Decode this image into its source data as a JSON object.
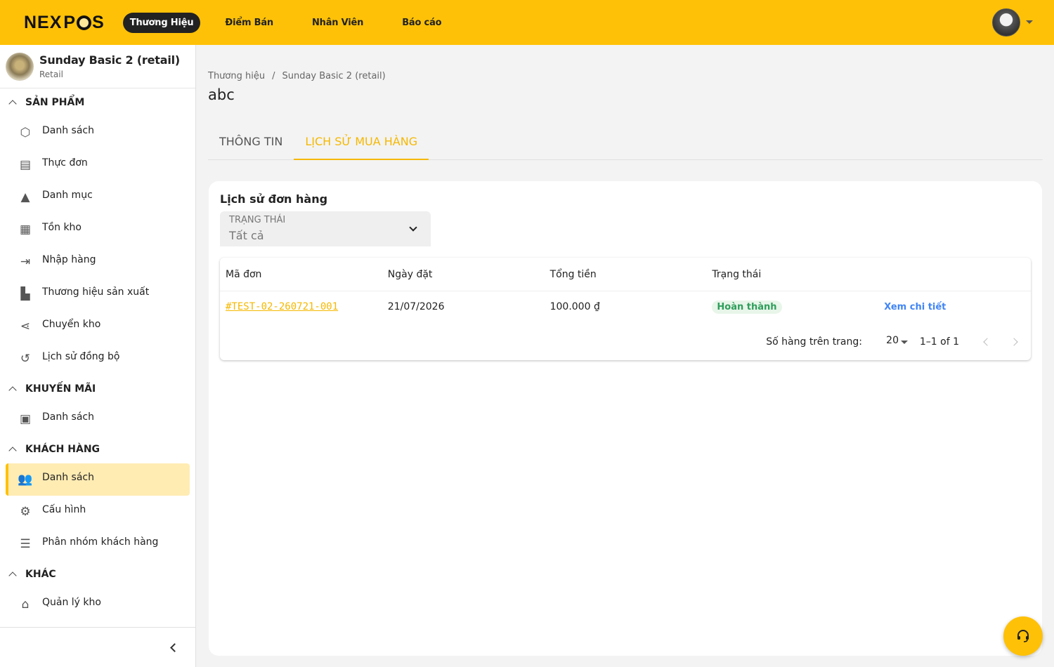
{
  "brand": {
    "logo_text": "NEXPOS",
    "accent": "#ffc107"
  },
  "nav": {
    "items": [
      "Thương Hiệu",
      "Điểm Bán",
      "Nhân Viên",
      "Báo cáo"
    ]
  },
  "store": {
    "name": "Sunday Basic 2 (retail)",
    "type": "Retail"
  },
  "sidebar": {
    "sections": [
      {
        "label": "SẢN PHẨM",
        "items": [
          "Danh sách",
          "Thực đơn",
          "Danh mục",
          "Tồn kho",
          "Nhập hàng",
          "Thương hiệu sản xuất",
          "Chuyển kho",
          "Lịch sử đồng bộ"
        ]
      },
      {
        "label": "KHUYẾN MÃI",
        "items": [
          "Danh sách"
        ]
      },
      {
        "label": "KHÁCH HÀNG",
        "items": [
          "Danh sách",
          "Cấu hình",
          "Phân nhóm khách hàng"
        ]
      },
      {
        "label": "KHÁC",
        "items": [
          "Quản lý kho"
        ]
      }
    ],
    "active": "KHÁCH HÀNG / Danh sách"
  },
  "breadcrumb": [
    "Thương hiệu",
    "Sunday Basic 2 (retail)"
  ],
  "page_title": "abc",
  "tabs": [
    "THÔNG TIN",
    "LỊCH SỬ MUA HÀNG"
  ],
  "card": {
    "title": "Lịch sử đơn hàng",
    "filter": {
      "label": "TRẠNG THÁI",
      "value": "Tất cả"
    },
    "columns": [
      "Mã đơn",
      "Ngày đặt",
      "Tổng tiền",
      "Trạng thái"
    ],
    "rows": [
      {
        "code": "#TEST-02-260721-001",
        "date": "21/07/2026",
        "total": "100.000 ₫",
        "status": "Hoàn thành",
        "action": "Xem chi tiết"
      }
    ],
    "pagination": {
      "rows_label": "Số hàng trên trang:",
      "rows_per_page": "20",
      "range": "1–1 of 1"
    }
  }
}
